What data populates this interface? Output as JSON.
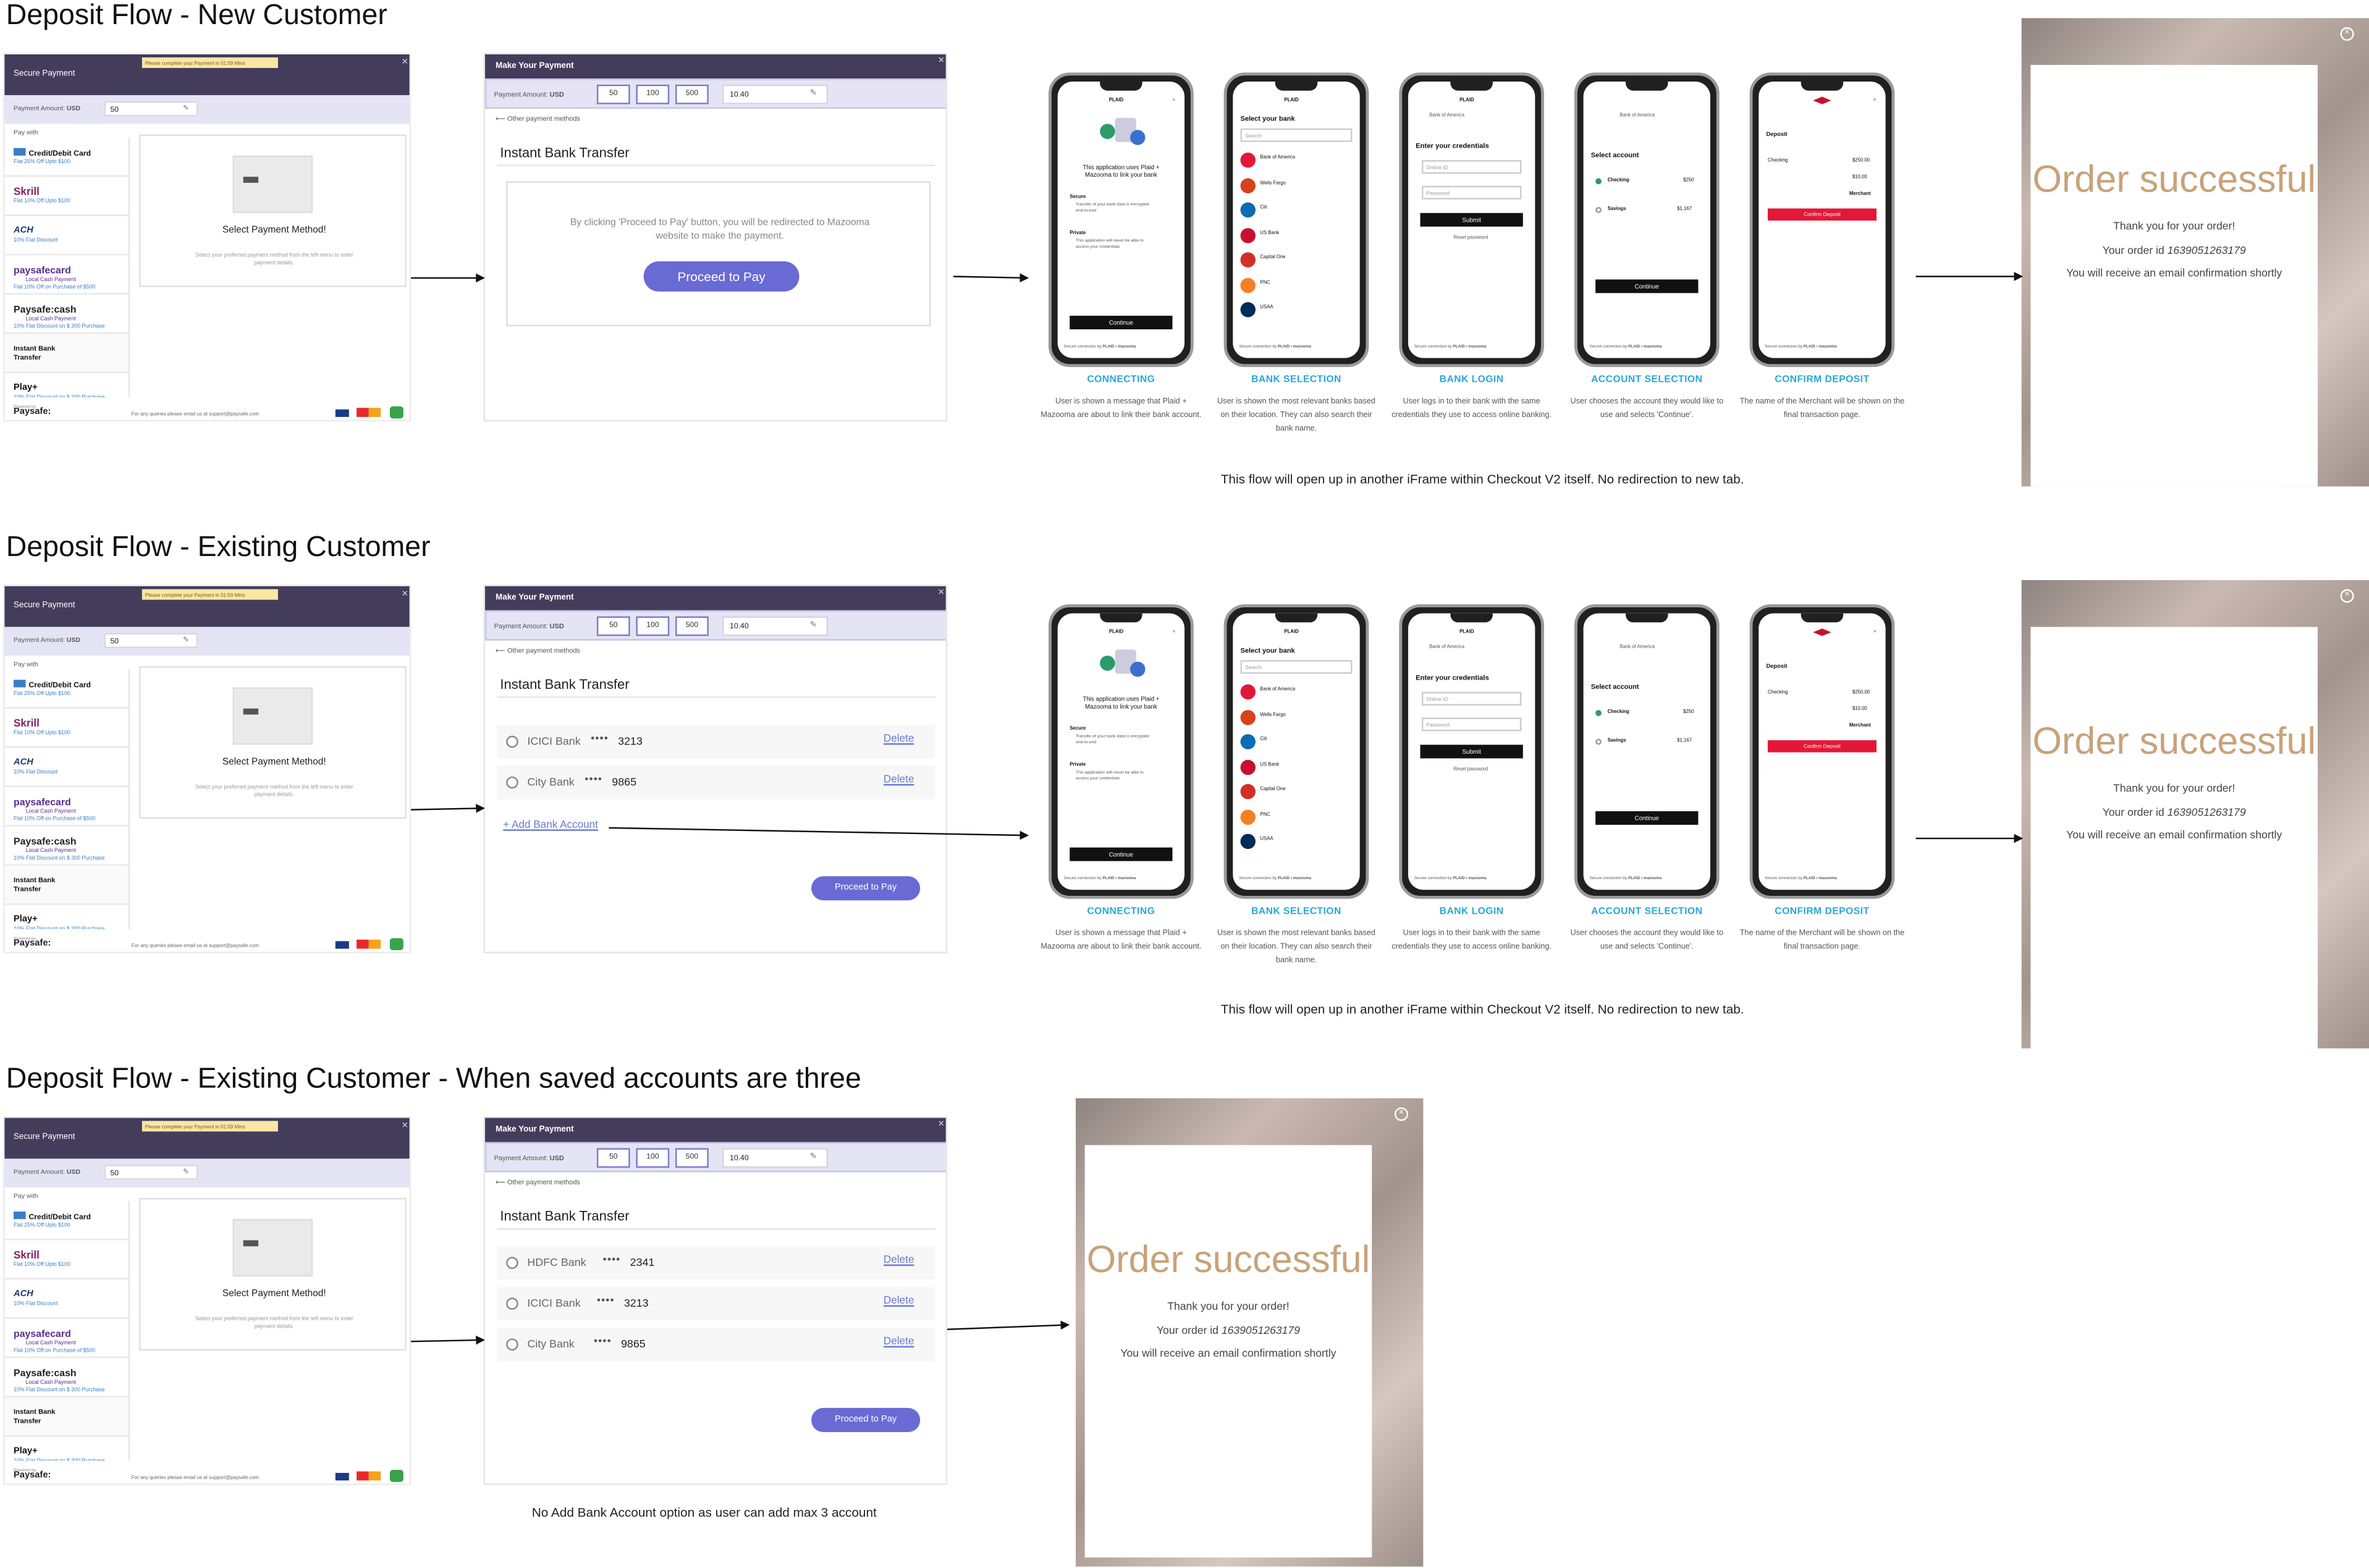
{
  "rows": [
    {
      "title": "Deposit Flow - New Customer"
    },
    {
      "title": "Deposit Flow - Existing Customer"
    },
    {
      "title": "Deposit Flow - Existing Customer - When saved accounts are three"
    }
  ],
  "secure_payment": {
    "title": "Secure Payment",
    "timer": "Please complete your Payment in 01:59 Mins",
    "amount_label": "Payment Amount:",
    "currency": "USD",
    "amount": "50",
    "pay_with": "Pay with",
    "methods": [
      {
        "label": "Credit/Debit Card",
        "sub": "Flat 25% Off Upto $100",
        "icon": "card-icon"
      },
      {
        "label": "Skrill",
        "sub": "Flat 10% Off Upto $100",
        "icon": "skrill-logo"
      },
      {
        "label": "ACH",
        "sub": "10% Flat Discount",
        "icon": "ach-logo"
      },
      {
        "label": "paysafecard",
        "sub2": "Local Cash Payment",
        "sub": "Flat 10% Off on Purchase of $500",
        "icon": "paysafecard-logo"
      },
      {
        "label": "Paysafe:cash",
        "sub2": "Local Cash Payment",
        "sub": "10% Flat Discount on $ 300 Purchase",
        "icon": "paysafecash-logo"
      },
      {
        "label": "Instant Bank Transfer",
        "sub": "",
        "icon": ""
      },
      {
        "label": "Play+",
        "sub": "10% Flat Discount on $ 300 Purchase",
        "icon": "playplus-logo"
      }
    ],
    "panel_title": "Select Payment Method!",
    "panel_sub": "Select your preferred payment method from the left menu to enter payment details.",
    "footer_powered": "Powered by",
    "footer_brand": "Paysafe:",
    "footer_query": "For any queries please email us at support@paysafe.com"
  },
  "make_payment": {
    "title": "Make Your Payment",
    "amount_label": "Payment Amount:",
    "currency": "USD",
    "chips": [
      "50",
      "100",
      "500"
    ],
    "amount": "10.40",
    "other_methods": "Other payment methods",
    "section_title": "Instant Bank Transfer",
    "redirect_text": "By clicking 'Proceed to Pay' button, you will be redirected to Mazooma website to make the payment.",
    "proceed_big": "Proceed to Pay",
    "proceed_small": "Proceed to Pay",
    "delete_label": "Delete",
    "add_bank": "+ Add Bank Account",
    "banks_two": [
      {
        "name": "ICICI Bank",
        "mask": "••••",
        "last4": "3213"
      },
      {
        "name": "City Bank",
        "mask": "••••",
        "last4": "9865"
      }
    ],
    "banks_three": [
      {
        "name": "HDFC Bank",
        "mask": "••••",
        "last4": "2341"
      },
      {
        "name": "ICICI Bank",
        "mask": "••••",
        "last4": "3213"
      },
      {
        "name": "City Bank",
        "mask": "••••",
        "last4": "9865"
      }
    ]
  },
  "phones": [
    {
      "label": "CONNECTING",
      "desc": "User is shown a message that Plaid + Mazooma are about to link their bank account."
    },
    {
      "label": "BANK SELECTION",
      "desc": "User is shown the most relevant banks based on their location. They can also search their bank name."
    },
    {
      "label": "BANK LOGIN",
      "desc": "User logs in to their bank with the same credentials they use to access online banking."
    },
    {
      "label": "ACCOUNT SELECTION",
      "desc": "User chooses the account they would like to use and selects 'Continue'."
    },
    {
      "label": "CONFIRM DEPOSIT",
      "desc": "The name of the Merchant will be shown on the final transaction page."
    }
  ],
  "screens": {
    "plaid": "PLAID",
    "connect_text": "This application uses Plaid + Mazooma to link your bank",
    "secure": "Secure",
    "secure_sub": "Transfer of your bank data is encrypted end-to-end",
    "private": "Private",
    "private_sub": "This application will never be able to access your credentials",
    "continue": "Continue",
    "select_bank": "Select your bank",
    "search": "Search",
    "bank_list": [
      "Bank of America",
      "Wells Fargo",
      "Citi",
      "US Bank",
      "Capital One",
      "PNC",
      "USAA"
    ],
    "enter_credentials": "Enter your credentials",
    "online_id": "Online ID",
    "password": "Password",
    "submit": "Submit",
    "reset": "Reset password",
    "bank_of_america": "Bank of America",
    "select_account": "Select account",
    "checking": "Checking",
    "checking_amt": "$250",
    "savings": "Savings",
    "savings_amt": "$1,167",
    "deposit": "Deposit",
    "dep_checking_amt": "$250.00",
    "dep_fee": "$10.00",
    "merchant": "Merchant",
    "confirm_deposit": "Confirm Deposit",
    "secure_conn": "Secure connection by",
    "plaid_mazooma": "PLAID • mazooma"
  },
  "success": {
    "title": "Order successful",
    "thanks": "Thank you for your order!",
    "order_prefix": "Your order id ",
    "order_id": "1639051263179",
    "email": "You will receive an email confirmation shortly",
    "close": "×"
  },
  "notes": {
    "iframe": "This flow will open up in another iFrame within Checkout V2 itself. No redirection to new tab.",
    "no_add": "No Add Bank Account option as user can add max 3 account"
  },
  "colors": {
    "header": "#433c5b",
    "accent": "#6a6ad4",
    "label_blue": "#27a8d8",
    "success_gold": "#c8a27a"
  }
}
